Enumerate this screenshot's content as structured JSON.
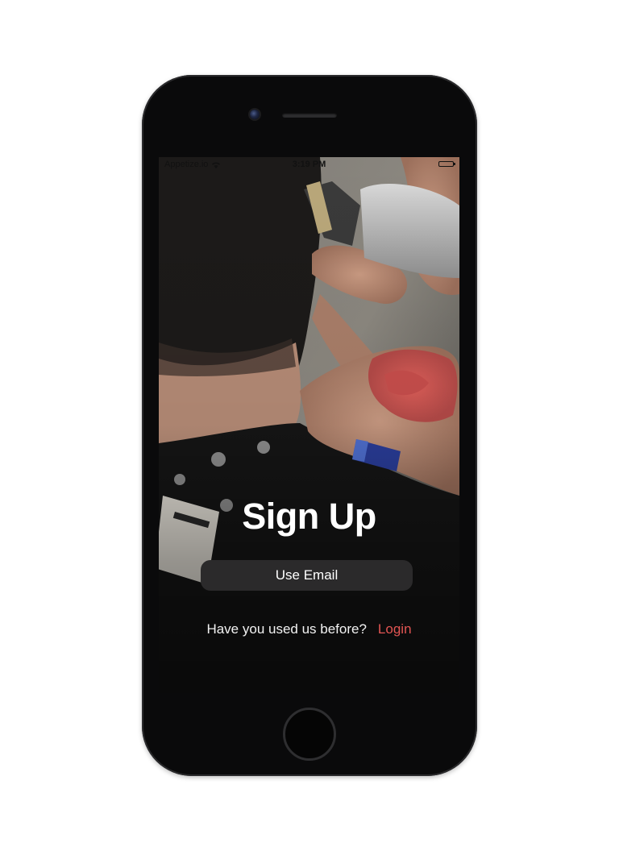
{
  "status_bar": {
    "carrier": "Appetize.io",
    "time": "3:19 PM"
  },
  "signup": {
    "title": "Sign Up",
    "email_button": "Use Email",
    "prompt": "Have you used us before?",
    "login_link": "Login"
  },
  "colors": {
    "accent": "#e25553",
    "button_bg": "#2b2a2b",
    "phone_body": "#0a0a0b"
  },
  "icons": [
    "wifi-icon",
    "battery-icon",
    "camera-icon",
    "speaker-icon",
    "home-button-icon"
  ]
}
